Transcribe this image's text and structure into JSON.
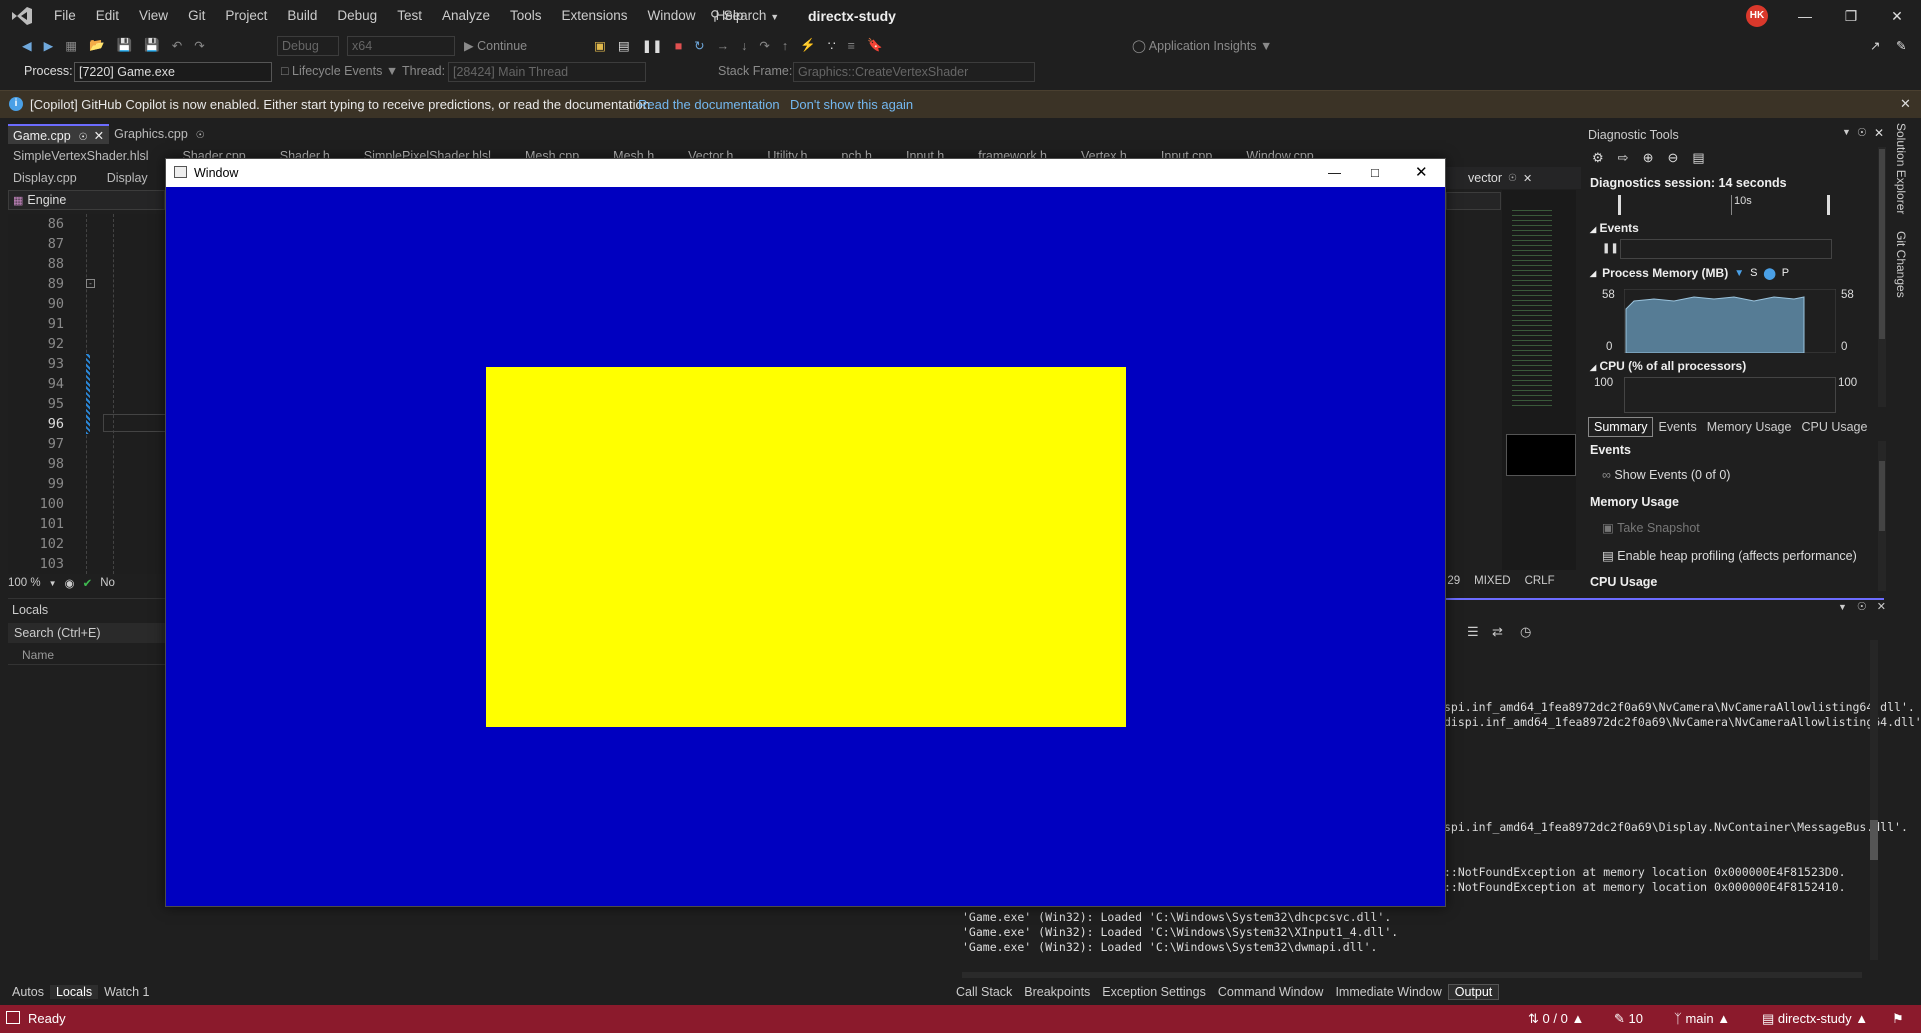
{
  "menu": [
    "File",
    "Edit",
    "View",
    "Git",
    "Project",
    "Build",
    "Debug",
    "Test",
    "Analyze",
    "Tools",
    "Extensions",
    "Window",
    "Help"
  ],
  "search_label": "Search",
  "app_title": "directx-study",
  "avatar_initials": "HK",
  "toolbar": {
    "config": "Debug",
    "platform": "x64",
    "continue": "Continue",
    "app_insights": "Application Insights"
  },
  "debug_bar": {
    "process_label": "Process:",
    "process_value": "[7220] Game.exe",
    "lifecycle": "Lifecycle Events",
    "thread_label": "Thread:",
    "thread_value": "[28424] Main Thread",
    "stack_label": "Stack Frame:",
    "stack_value": "Graphics::CreateVertexShader"
  },
  "infobar": {
    "message": "[Copilot] GitHub Copilot is now enabled. Either start typing to receive predictions, or read the documentation",
    "link1": "Read the documentation",
    "link2": "Don't show this again"
  },
  "tabs_row1": [
    {
      "label": "Game.cpp",
      "active": true
    },
    {
      "label": "Graphics.cpp",
      "active": false
    }
  ],
  "tabs_row2": [
    "SimpleVertexShader.hlsl",
    "Shader.cpp",
    "Shader.h",
    "SimplePixelShader.hlsl",
    "Mesh.cpp",
    "Mesh.h",
    "Vector.h",
    "Utility.h",
    "pch.h",
    "Input.h",
    "framework.h",
    "Vertex.h",
    "Input.cpp",
    "Window.cpp"
  ],
  "tabs_row3": [
    "Display.cpp",
    "Display"
  ],
  "scope": "Engine",
  "line_numbers": [
    "86",
    "87",
    "88",
    "89",
    "90",
    "91",
    "92",
    "93",
    "94",
    "95",
    "96",
    "97",
    "98",
    "99",
    "100",
    "101",
    "102",
    "103"
  ],
  "current_line": "96",
  "editor_status": {
    "zoom": "100 %",
    "issues": "No",
    "col": "ol: 29",
    "encoding": "MIXED",
    "eol": "CRLF"
  },
  "right_tab": "vector",
  "locals": {
    "title": "Locals",
    "search_placeholder": "Search (Ctrl+E)",
    "col_name": "Name"
  },
  "bottom_left_tabs": [
    "Autos",
    "Locals",
    "Watch 1"
  ],
  "bottom_right_tabs": [
    "Call Stack",
    "Breakpoints",
    "Exception Settings",
    "Command Window",
    "Immediate Window",
    "Output"
  ],
  "diagnostics": {
    "title": "Diagnostic Tools",
    "session": "Diagnostics session: 14 seconds",
    "timeline_mark": "10s",
    "events_label": "Events",
    "memory_label": "Process Memory (MB)",
    "memory_legend1": "S",
    "memory_legend2": "P",
    "mem_max": "58",
    "mem_min": "0",
    "cpu_label": "CPU (% of all processors)",
    "cpu_max": "100",
    "tabs": [
      "Summary",
      "Events",
      "Memory Usage",
      "CPU Usage"
    ],
    "sec_events": "Events",
    "show_events": "Show Events (0 of 0)",
    "sec_memory": "Memory Usage",
    "take_snapshot": "Take Snapshot",
    "heap_profiling": "Enable heap profiling (affects performance)",
    "sec_cpu": "CPU Usage"
  },
  "side_tabs": [
    "Solution Explorer",
    "Git Changes"
  ],
  "output_lines_right": [
    "spi.inf_amd64_1fea8972dc2f0a69\\NvCamera\\NvCameraAllowlisting64.dll'.",
    "dispi.inf_amd64_1fea8972dc2f0a69\\NvCamera\\NvCameraAllowlisting64.dll'.",
    "spi.inf_amd64_1fea8972dc2f0a69\\Display.NvContainer\\MessageBus.dll'.",
    "::NotFoundException at memory location 0x000000E4F81523D0.",
    "::NotFoundException at memory location 0x000000E4F8152410."
  ],
  "output_lines_bottom": [
    "'Game.exe' (Win32): Loaded 'C:\\Windows\\System32\\dhcpcsvc.dll'.",
    "'Game.exe' (Win32): Loaded 'C:\\Windows\\System32\\XInput1_4.dll'.",
    "'Game.exe' (Win32): Loaded 'C:\\Windows\\System32\\dwmapi.dll'."
  ],
  "status": {
    "ready": "Ready",
    "sync": "0 / 0",
    "edits": "10",
    "branch": "main",
    "repo": "directx-study"
  },
  "game_window": {
    "title": "Window",
    "background": "#0000c0",
    "rect_color": "#ffff00"
  },
  "colors": {
    "status_bar": "#8b1a2c",
    "accent": "#6c6cff",
    "link": "#74b8f0"
  }
}
